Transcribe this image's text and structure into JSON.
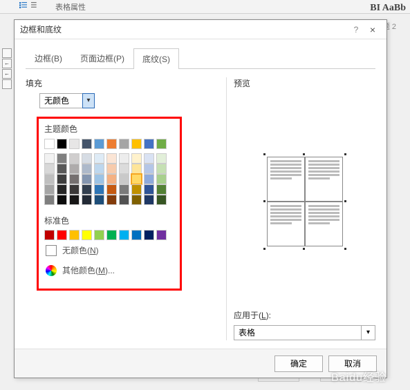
{
  "ribbon": {
    "label": "表格属性",
    "subheading": "题 2",
    "bi_text": "BI AaBb"
  },
  "dialog": {
    "title": "边框和底纹",
    "help": "?",
    "close": "×",
    "tabs": {
      "border": "边框(B)",
      "page_border": "页面边框(P)",
      "shading": "底纹(S)"
    },
    "fill": {
      "label": "填充",
      "value": "无颜色",
      "caret": "▾"
    },
    "palette": {
      "theme_label": "主题颜色",
      "std_label": "标准色",
      "no_color": "无颜色(N)",
      "more_colors": "其他颜色(M)...",
      "theme_row1": [
        "#ffffff",
        "#000000",
        "#e7e6e6",
        "#44546a",
        "#5b9bd5",
        "#ed7d31",
        "#a5a5a5",
        "#ffc000",
        "#4472c4",
        "#70ad47"
      ],
      "theme_shades": [
        [
          "#f2f2f2",
          "#808080",
          "#d0cece",
          "#d6dce4",
          "#deebf6",
          "#fbe5d5",
          "#ededed",
          "#fff2cc",
          "#d9e2f3",
          "#e2efd9"
        ],
        [
          "#d8d8d8",
          "#595959",
          "#aeabab",
          "#adb9ca",
          "#bdd7ee",
          "#f7cbac",
          "#dbdbdb",
          "#fee599",
          "#b4c6e7",
          "#c5e0b3"
        ],
        [
          "#bfbfbf",
          "#3f3f3f",
          "#757070",
          "#8496b0",
          "#9cc3e5",
          "#f4b183",
          "#c9c9c9",
          "#ffd965",
          "#8eaadb",
          "#a8d08d"
        ],
        [
          "#a5a5a5",
          "#262626",
          "#3a3838",
          "#323f4f",
          "#2e75b5",
          "#c55a11",
          "#7b7b7b",
          "#bf9000",
          "#2f5496",
          "#538135"
        ],
        [
          "#7f7f7f",
          "#0c0c0c",
          "#171616",
          "#222a35",
          "#1e4e79",
          "#833c0b",
          "#525252",
          "#7f6000",
          "#1f3864",
          "#375623"
        ]
      ],
      "standard": [
        "#c00000",
        "#ff0000",
        "#ffc000",
        "#ffff00",
        "#92d050",
        "#00b050",
        "#00b0f0",
        "#0070c0",
        "#002060",
        "#7030a0"
      ]
    },
    "preview": {
      "label": "预览",
      "apply_label": "应用于(L):",
      "apply_value": "表格",
      "caret": "▾"
    },
    "buttons": {
      "ok": "确定",
      "cancel": "取消"
    }
  },
  "watermark": "Baidu经验"
}
